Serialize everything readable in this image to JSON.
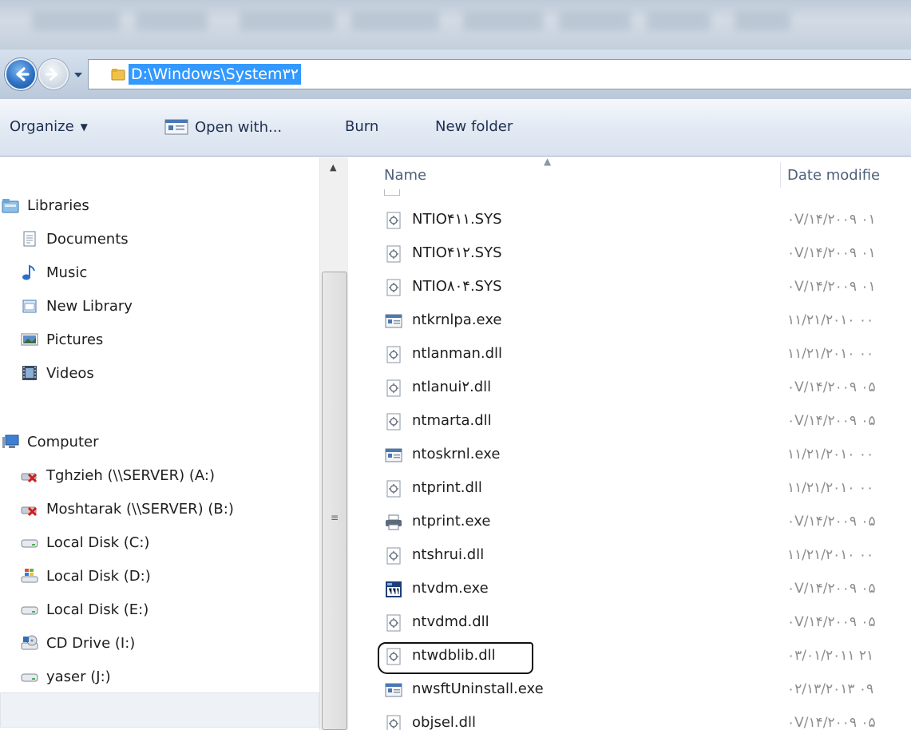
{
  "address": {
    "path": "D:\\Windows\\System۳۲"
  },
  "toolbar": {
    "organize": "Organize",
    "open_with": "Open with...",
    "burn": "Burn",
    "new_folder": "New folder"
  },
  "nav": {
    "libraries": "Libraries",
    "library_items": [
      {
        "label": "Documents",
        "icon": "document-icon"
      },
      {
        "label": "Music",
        "icon": "music-icon"
      },
      {
        "label": "New Library",
        "icon": "library-icon"
      },
      {
        "label": "Pictures",
        "icon": "pictures-icon"
      },
      {
        "label": "Videos",
        "icon": "videos-icon"
      }
    ],
    "computer": "Computer",
    "drives": [
      {
        "label": "Tghzieh (\\\\SERVER) (A:)",
        "icon": "disconnected-network-drive-icon"
      },
      {
        "label": "Moshtarak (\\\\SERVER) (B:)",
        "icon": "disconnected-network-drive-icon"
      },
      {
        "label": "Local Disk (C:)",
        "icon": "drive-icon"
      },
      {
        "label": "Local Disk (D:)",
        "icon": "windows-drive-icon"
      },
      {
        "label": "Local Disk (E:)",
        "icon": "drive-icon"
      },
      {
        "label": "CD Drive (I:)",
        "icon": "cd-drive-icon"
      },
      {
        "label": "yaser (J:)",
        "icon": "drive-icon"
      }
    ]
  },
  "columns": {
    "name": "Name",
    "date": "Date modifie"
  },
  "files": [
    {
      "name": "NTIO۴۱۱.SYS",
      "date": "۰V/۱۴/۲۰۰۹ ۰۱",
      "icon": "system-file-icon"
    },
    {
      "name": "NTIO۴۱۲.SYS",
      "date": "۰V/۱۴/۲۰۰۹ ۰۱",
      "icon": "system-file-icon"
    },
    {
      "name": "NTIO۸۰۴.SYS",
      "date": "۰V/۱۴/۲۰۰۹ ۰۱",
      "icon": "system-file-icon"
    },
    {
      "name": "ntkrnlpa.exe",
      "date": "۱۱/۲۱/۲۰۱۰ ۰۰",
      "icon": "exe-icon"
    },
    {
      "name": "ntlanman.dll",
      "date": "۱۱/۲۱/۲۰۱۰ ۰۰",
      "icon": "system-file-icon"
    },
    {
      "name": "ntlanui۲.dll",
      "date": "۰V/۱۴/۲۰۰۹ ۰۵",
      "icon": "system-file-icon"
    },
    {
      "name": "ntmarta.dll",
      "date": "۰V/۱۴/۲۰۰۹ ۰۵",
      "icon": "system-file-icon"
    },
    {
      "name": "ntoskrnl.exe",
      "date": "۱۱/۲۱/۲۰۱۰ ۰۰",
      "icon": "exe-icon"
    },
    {
      "name": "ntprint.dll",
      "date": "۱۱/۲۱/۲۰۱۰ ۰۰",
      "icon": "system-file-icon"
    },
    {
      "name": "ntprint.exe",
      "date": "۰V/۱۴/۲۰۰۹ ۰۵",
      "icon": "printer-icon"
    },
    {
      "name": "ntshrui.dll",
      "date": "۱۱/۲۱/۲۰۱۰ ۰۰",
      "icon": "system-file-icon"
    },
    {
      "name": "ntvdm.exe",
      "date": "۰V/۱۴/۲۰۰۹ ۰۵",
      "icon": "dos-app-icon"
    },
    {
      "name": "ntvdmd.dll",
      "date": "۰V/۱۴/۲۰۰۹ ۰۵",
      "icon": "system-file-icon"
    },
    {
      "name": "ntwdblib.dll",
      "date": "۰۳/۰۱/۲۰۱۱ ۲۱",
      "icon": "system-file-icon"
    },
    {
      "name": "nwsftUninstall.exe",
      "date": "۰۲/۱۳/۲۰۱۳ ۰۹",
      "icon": "exe-icon"
    },
    {
      "name": "objsel.dll",
      "date": "۰V/۱۴/۲۰۰۹ ۰۵",
      "icon": "system-file-icon"
    }
  ]
}
